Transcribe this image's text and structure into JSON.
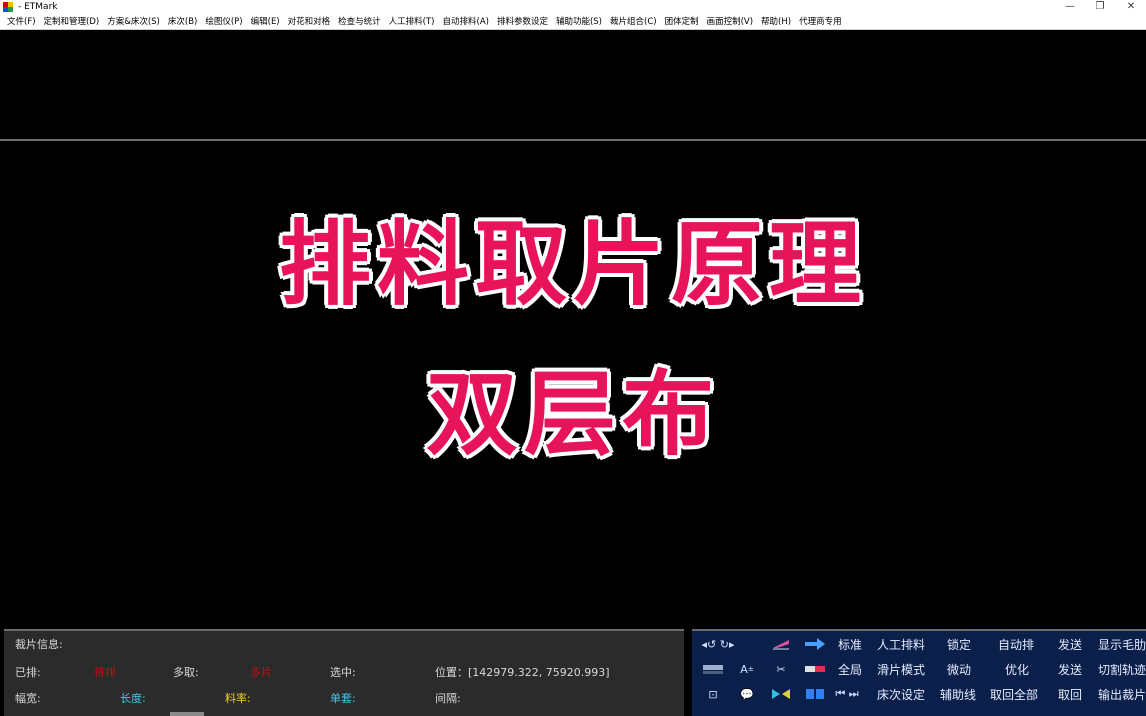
{
  "window": {
    "title": "- ETMark",
    "minimize": "—",
    "restore": "❐",
    "close": "✕"
  },
  "menu": [
    "文件(F)",
    "定制和管理(D)",
    "方案&床次(S)",
    "床次(B)",
    "绘图仪(P)",
    "编辑(E)",
    "对花和对格",
    "检查与统计",
    "人工排料(T)",
    "自动排料(A)",
    "排料参数设定",
    "辅助功能(S)",
    "裁片组合(C)",
    "团体定制",
    "画面控制(V)",
    "帮助(H)",
    "代理商专用"
  ],
  "canvas": {
    "title_line1": "排料取片原理",
    "title_line2": "双层布"
  },
  "info": {
    "header": "裁片信息:",
    "arranged": "已排:",
    "arranged_value": "待排",
    "excess": "多取:",
    "excess_value": "多片",
    "selected": "选中:",
    "position": "位置：[142979.322, 75920.993]",
    "width": "幅宽:",
    "length": "长度:",
    "rate": "料率:",
    "single_set": "单套:",
    "gap": "间隔:"
  },
  "toolbar": {
    "row1": [
      "标准",
      "人工排料",
      "锁定",
      "自动排",
      "发送",
      "显示毛肋"
    ],
    "row2": [
      "全局",
      "滑片模式",
      "微动",
      "优化",
      "发送",
      "切割轨迹"
    ],
    "row3": [
      "床次设定",
      "辅助线",
      "取回全部",
      "取回",
      "输出裁片"
    ]
  },
  "colors": {
    "title_fill": "#e8145a",
    "title_outline": "#ffffff",
    "info_bg": "#2b2b2b",
    "toolbar_bg": "#0a1f4a"
  }
}
